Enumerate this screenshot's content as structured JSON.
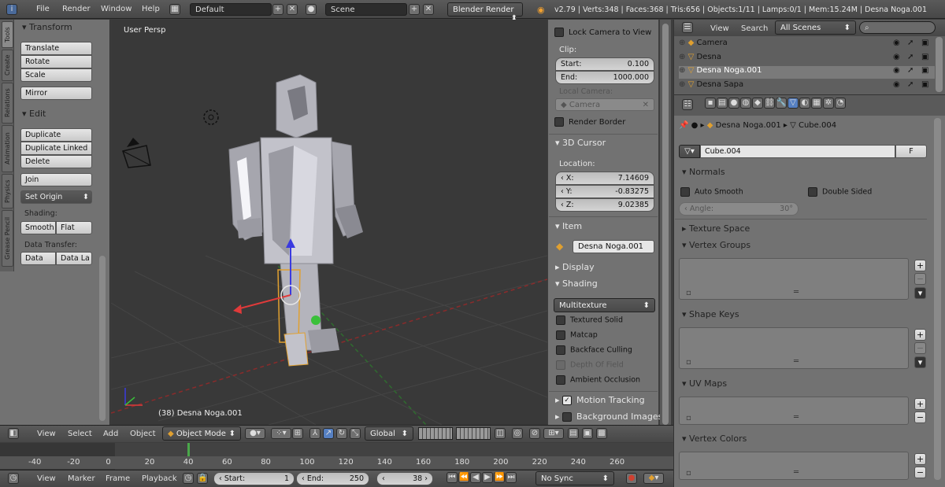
{
  "topbar": {
    "menus": [
      "File",
      "Render",
      "Window",
      "Help"
    ],
    "layout": "Default",
    "scene": "Scene",
    "engine": "Blender Render",
    "stats": "v2.79 | Verts:348 | Faces:368 | Tris:656 | Objects:1/11 | Lamps:0/1 | Mem:15.24M | Desna Noga.001"
  },
  "tools": {
    "tabs": [
      "Tools",
      "Create",
      "Relations",
      "Animation",
      "Physics",
      "Grease Pencil"
    ],
    "transform": {
      "title": "Transform",
      "buttons": [
        "Translate",
        "Rotate",
        "Scale"
      ],
      "mirror": "Mirror"
    },
    "edit": {
      "title": "Edit",
      "buttons": [
        "Duplicate",
        "Duplicate Linked",
        "Delete"
      ],
      "join": "Join",
      "set_origin": "Set Origin",
      "shading_label": "Shading:",
      "smooth": "Smooth",
      "flat": "Flat",
      "data_transfer_label": "Data Transfer:",
      "data": "Data",
      "data_la": "Data La"
    }
  },
  "viewport": {
    "label": "User Persp",
    "object_label": "(38) Desna Noga.001"
  },
  "npanel": {
    "lock_camera": "Lock Camera to View",
    "clip_label": "Clip:",
    "start_label": "Start:",
    "start_value": "0.100",
    "end_label": "End:",
    "end_value": "1000.000",
    "local_camera_label": "Local Camera:",
    "camera": "Camera",
    "render_border": "Render Border",
    "cursor_title": "3D Cursor",
    "location_label": "Location:",
    "x_label": "X:",
    "x_value": "7.14609",
    "y_label": "Y:",
    "y_value": "-0.83275",
    "z_label": "Z:",
    "z_value": "9.02385",
    "item_title": "Item",
    "item_name": "Desna Noga.001",
    "display_title": "Display",
    "shading_title": "Shading",
    "shading_mode": "Multitexture",
    "shading_opts": [
      "Textured Solid",
      "Matcap",
      "Backface Culling",
      "Depth Of Field",
      "Ambient Occlusion"
    ],
    "motion_tracking": "Motion Tracking",
    "background_images": "Background Images"
  },
  "outliner": {
    "view": "View",
    "search": "Search",
    "scenes": "All Scenes",
    "items": [
      "Camera",
      "Desna",
      "Desna Noga.001",
      "Desna Sapa"
    ]
  },
  "properties": {
    "breadcrumb_obj": "Desna Noga.001",
    "breadcrumb_mesh": "Cube.004",
    "mesh_name": "Cube.004",
    "f": "F",
    "normals": "Normals",
    "auto_smooth": "Auto Smooth",
    "double_sided": "Double Sided",
    "angle_label": "Angle:",
    "angle_value": "30°",
    "texture_space": "Texture Space",
    "vertex_groups": "Vertex Groups",
    "shape_keys": "Shape Keys",
    "uv_maps": "UV Maps",
    "vertex_colors": "Vertex Colors"
  },
  "viewhdr": {
    "view": "View",
    "select": "Select",
    "add": "Add",
    "object": "Object",
    "mode": "Object Mode",
    "orientation": "Global"
  },
  "timeline": {
    "ticks": [
      "-40",
      "-20",
      "0",
      "20",
      "40",
      "60",
      "80",
      "100",
      "120",
      "140",
      "160",
      "180",
      "200",
      "220",
      "240",
      "260"
    ],
    "view": "View",
    "marker": "Marker",
    "frame": "Frame",
    "playback": "Playback",
    "start_label": "Start:",
    "start_value": "1",
    "end_label": "End:",
    "end_value": "250",
    "current": "38",
    "sync": "No Sync"
  }
}
